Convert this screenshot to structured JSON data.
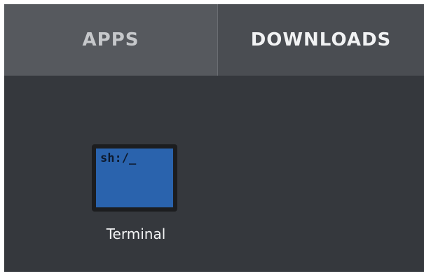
{
  "tabs": {
    "apps_label": "APPS",
    "downloads_label": "DOWNLOADS",
    "active": "DOWNLOADS"
  },
  "apps": [
    {
      "name": "Terminal",
      "icon": "terminal-icon",
      "icon_text": "sh:/_"
    }
  ],
  "colors": {
    "panel_background": "#35383d",
    "tab_inactive": "#56595e",
    "tab_active": "#4a4d52",
    "terminal_screen": "#2a63ad"
  }
}
